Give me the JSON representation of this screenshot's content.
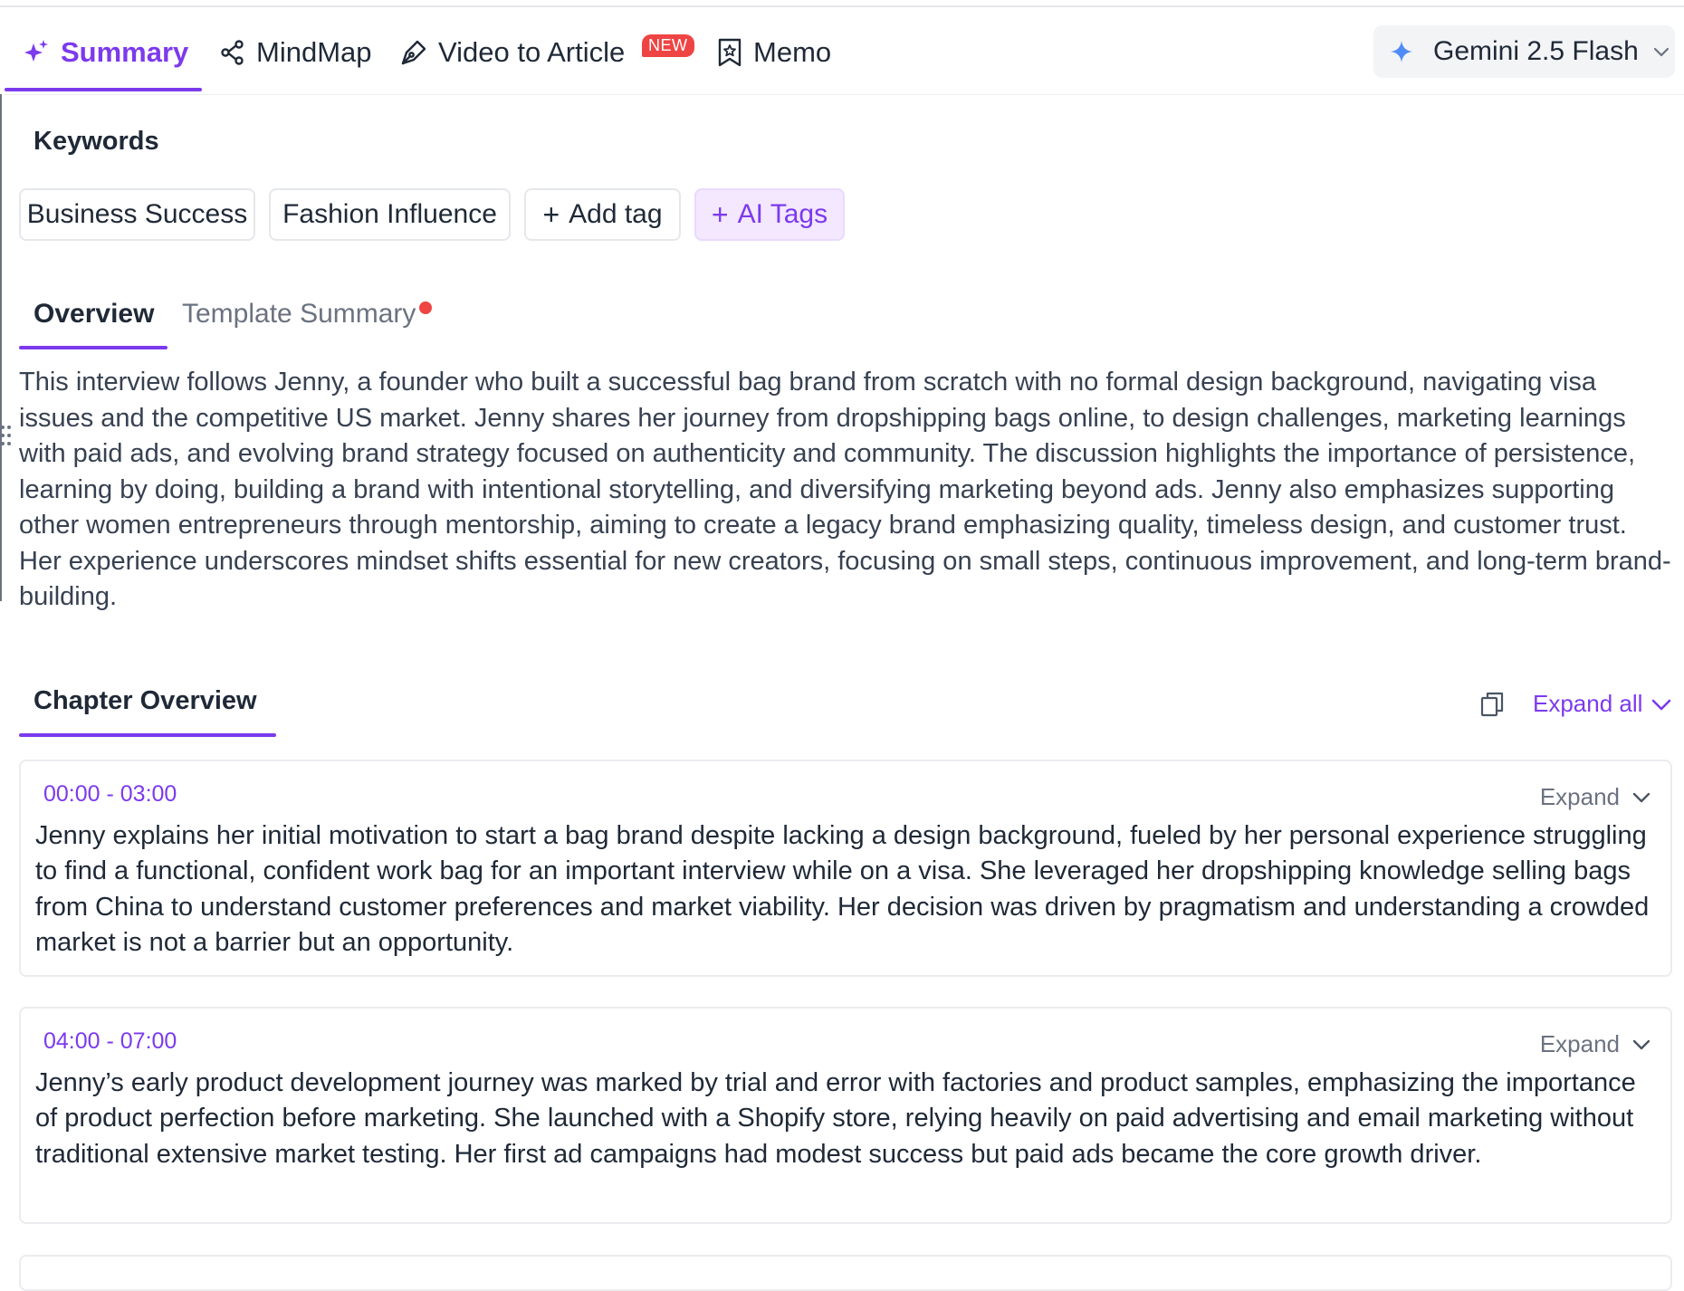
{
  "nav": {
    "tabs": [
      {
        "label": "Summary",
        "icon": "sparkle-icon",
        "active": true
      },
      {
        "label": "MindMap",
        "icon": "mindmap-icon",
        "active": false
      },
      {
        "label": "Video to Article",
        "icon": "pen-icon",
        "active": false
      },
      {
        "label": "Memo",
        "icon": "bookmark-star-icon",
        "active": false
      }
    ],
    "new_badge": "NEW",
    "model": "Gemini 2.5 Flash"
  },
  "keywords": {
    "title": "Keywords",
    "tags": [
      "Business Success",
      "Fashion Influence"
    ],
    "add_tag_label": "Add tag",
    "ai_tags_label": "AI Tags"
  },
  "overview": {
    "tabs": [
      "Overview",
      "Template Summary"
    ],
    "text": "This interview follows Jenny, a founder who built a successful bag brand from scratch with no formal design background, navigating visa issues and the competitive US market. Jenny shares her journey from dropshipping bags online, to design challenges, marketing learnings with paid ads, and evolving brand strategy focused on authenticity and community. The discussion highlights the importance of persistence, learning by doing, building a brand with intentional storytelling, and diversifying marketing beyond ads. Jenny also emphasizes supporting other women entrepreneurs through mentorship, aiming to create a legacy brand emphasizing quality, timeless design, and customer trust. Her experience underscores mindset shifts essential for new creators, focusing on small steps, continuous improvement, and long-term brand-building."
  },
  "chapters": {
    "title": "Chapter Overview",
    "expand_all_label": "Expand all",
    "items": [
      {
        "time": "00:00  -  03:00",
        "expand_label": "Expand",
        "text": "Jenny explains her initial motivation to start a bag brand despite lacking a design background, fueled by her personal experience struggling to find a functional, confident work bag for an important interview while on a visa. She leveraged her dropshipping knowledge selling bags from China to understand customer preferences and market viability. Her decision was driven by pragmatism and understanding a crowded market is not a barrier but an opportunity."
      },
      {
        "time": "04:00  -  07:00",
        "expand_label": "Expand",
        "text": "Jenny’s early product development journey was marked by trial and error with factories and product samples, emphasizing the importance of product perfection before marketing. She launched with a Shopify store, relying heavily on paid advertising and email marketing without traditional extensive market testing. Her first ad campaigns had modest success but paid ads became the core growth driver."
      }
    ]
  },
  "colors": {
    "accent": "#7c3aed",
    "badge": "#ef4444",
    "ai_tag_bg": "#f3e8ff"
  }
}
